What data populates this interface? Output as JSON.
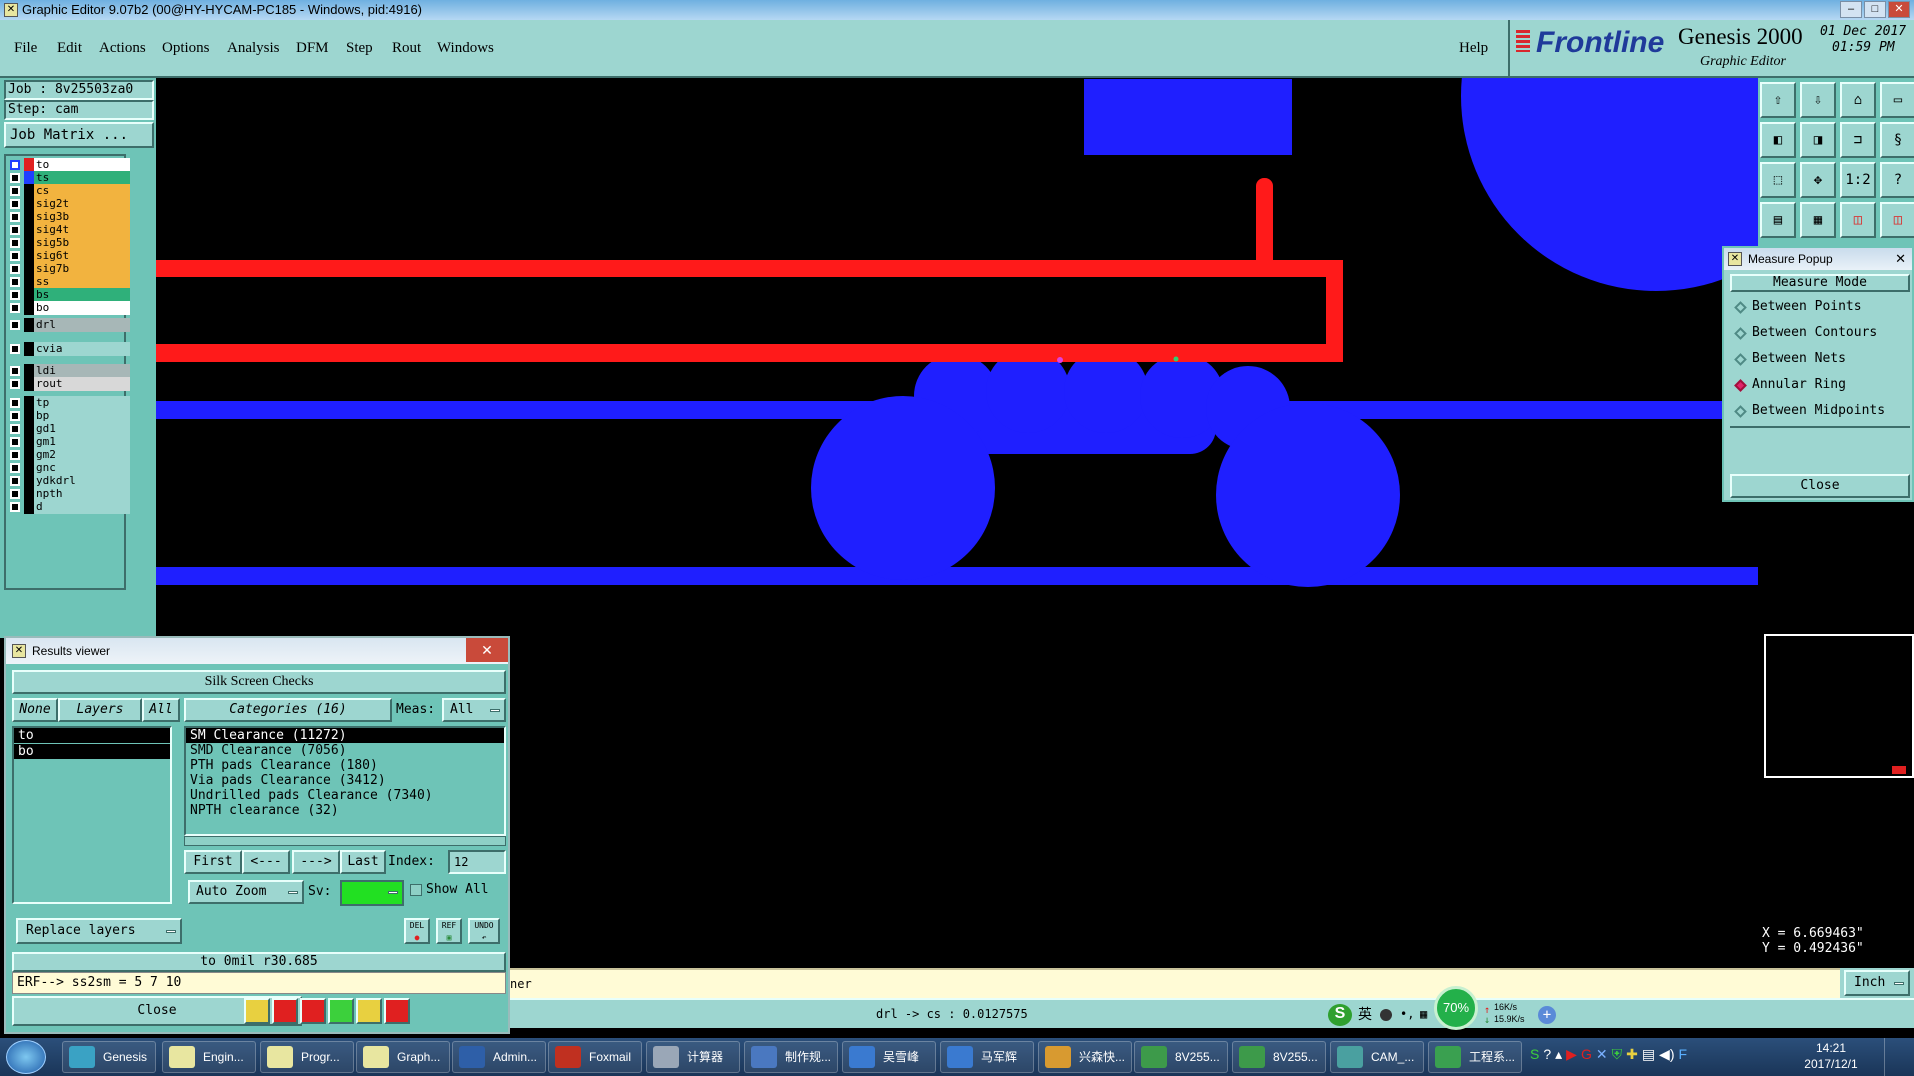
{
  "window": {
    "title": "Graphic Editor 9.07b2 (00@HY-HYCAM-PC185 - Windows, pid:4916)"
  },
  "menu": {
    "items": [
      "File",
      "Edit",
      "Actions",
      "Options",
      "Analysis",
      "DFM",
      "Step",
      "Rout",
      "Windows"
    ],
    "help": "Help"
  },
  "brand": {
    "logo": "Frontline",
    "product": "Genesis 2000",
    "subtitle": "Graphic Editor",
    "date": "01 Dec 2017",
    "time": "01:59 PM"
  },
  "job": {
    "job_label": "Job : 8v25503za0",
    "step_label": "Step: cam",
    "matrix_button": "Job Matrix ..."
  },
  "layers": [
    {
      "name": "to",
      "color": "#ffffff",
      "swatch": "#e02020",
      "marker": true
    },
    {
      "name": "ts",
      "color": "#2fb07a",
      "swatch": "#1f3fff"
    },
    {
      "name": "cs",
      "color": "#f2b33f"
    },
    {
      "name": "sig2t",
      "color": "#f2b33f"
    },
    {
      "name": "sig3b",
      "color": "#f2b33f"
    },
    {
      "name": "sig4t",
      "color": "#f2b33f"
    },
    {
      "name": "sig5b",
      "color": "#f2b33f"
    },
    {
      "name": "sig6t",
      "color": "#f2b33f"
    },
    {
      "name": "sig7b",
      "color": "#f2b33f"
    },
    {
      "name": "ss",
      "color": "#f2b33f"
    },
    {
      "name": "bs",
      "color": "#2fb07a"
    },
    {
      "name": "bo",
      "color": "#ffffff"
    },
    {
      "name": "drl",
      "color": "#a7b7b7"
    },
    {
      "name": "cvia",
      "color": "#9dd6d0"
    },
    {
      "name": "ldi",
      "color": "#a7b7b7"
    },
    {
      "name": "rout",
      "color": "#d8d8d8"
    },
    {
      "name": "tp",
      "color": "#9dd6d0"
    },
    {
      "name": "bp",
      "color": "#9dd6d0"
    },
    {
      "name": "gd1",
      "color": "#9dd6d0"
    },
    {
      "name": "gm1",
      "color": "#9dd6d0"
    },
    {
      "name": "gm2",
      "color": "#9dd6d0"
    },
    {
      "name": "gnc",
      "color": "#9dd6d0"
    },
    {
      "name": "ydkdrl",
      "color": "#9dd6d0"
    },
    {
      "name": "npth",
      "color": "#9dd6d0"
    },
    {
      "name": "d",
      "color": "#9dd6d0"
    }
  ],
  "toolbar": {
    "icons": [
      "zoom-home-icon",
      "zoom-in-icon",
      "zoom-out-icon",
      "screen-icon",
      "pan-left-icon",
      "pan-right-icon",
      "fit-icon",
      "snap-icon",
      "zoom-area-icon",
      "pan-center-icon",
      "scale-icon",
      "help-icon",
      "clipboard-icon",
      "grid-icon",
      "layers-a-icon",
      "layers-b-icon"
    ],
    "scale_label": "1:2",
    "help_label": "?"
  },
  "measure": {
    "title": "Measure Popup",
    "mode_label": "Measure Mode",
    "options": [
      {
        "label": "Between Points",
        "selected": false
      },
      {
        "label": "Between Contours",
        "selected": false
      },
      {
        "label": "Between Nets",
        "selected": false
      },
      {
        "label": "Annular Ring",
        "selected": true
      },
      {
        "label": "Between Midpoints",
        "selected": false
      }
    ],
    "close_label": "Close"
  },
  "coords": {
    "x": "X = 6.669463\"",
    "y": "Y = 0.492436\""
  },
  "results": {
    "title": "Results viewer",
    "section": "Silk Screen Checks",
    "none_label": "None",
    "layers_label": "Layers",
    "all_label": "All",
    "categories_label": "Categories (16)",
    "meas_label": "Meas:",
    "meas_value": "All",
    "layer_items": [
      "to",
      "bo"
    ],
    "category_items": [
      "SM Clearance (11272)",
      "SMD Clearance (7056)",
      "PTH pads Clearance (180)",
      "Via pads Clearance (3412)",
      "Undrilled pads Clearance (7340)",
      "NPTH clearance (32)"
    ],
    "first_label": "First",
    "prev_label": "<---",
    "next_label": "--->",
    "last_label": "Last",
    "index_label": "Index:",
    "index_value": "12",
    "auto_zoom_label": "Auto Zoom",
    "sv_label": "Sv:",
    "show_all_label": "Show All",
    "replace_label": "Replace layers",
    "del_label": "DEL",
    "ref_label": "REF",
    "undo_label": "UNDO",
    "measure_readout": "to 0mil   r30.685",
    "erf_line": "ERF--> ss2sm = 5 7 10",
    "close_label": "Close"
  },
  "prompt": {
    "text": "ner"
  },
  "unit": {
    "label": "Inch"
  },
  "status": {
    "text": "drl -> cs : 0.0127575",
    "ime": "英",
    "pct": "70%",
    "up": "16K/s",
    "down": "15.9K/s"
  },
  "taskbar": {
    "items": [
      {
        "label": "Genesis",
        "color": "#3aa2c4"
      },
      {
        "label": "Engin...",
        "color": "#e8e6a0"
      },
      {
        "label": "Progr...",
        "color": "#e8e6a0"
      },
      {
        "label": "Graph...",
        "color": "#e8e6a0"
      },
      {
        "label": "Admin...",
        "color": "#2e5fa8"
      },
      {
        "label": "Foxmail",
        "color": "#c03020"
      },
      {
        "label": "计算器",
        "color": "#9aa7b7"
      },
      {
        "label": "制作规...",
        "color": "#4a78c0"
      },
      {
        "label": "吴雪峰",
        "color": "#3a7ad0"
      },
      {
        "label": "马军辉",
        "color": "#3a7ad0"
      },
      {
        "label": "兴森快...",
        "color": "#d89a30"
      },
      {
        "label": "8V255...",
        "color": "#3d9a4a"
      },
      {
        "label": "8V255...",
        "color": "#3d9a4a"
      },
      {
        "label": "CAM_...",
        "color": "#4aa0a0"
      },
      {
        "label": "工程系...",
        "color": "#3aa050"
      }
    ],
    "clock_time": "14:21",
    "clock_date": "2017/12/1"
  }
}
